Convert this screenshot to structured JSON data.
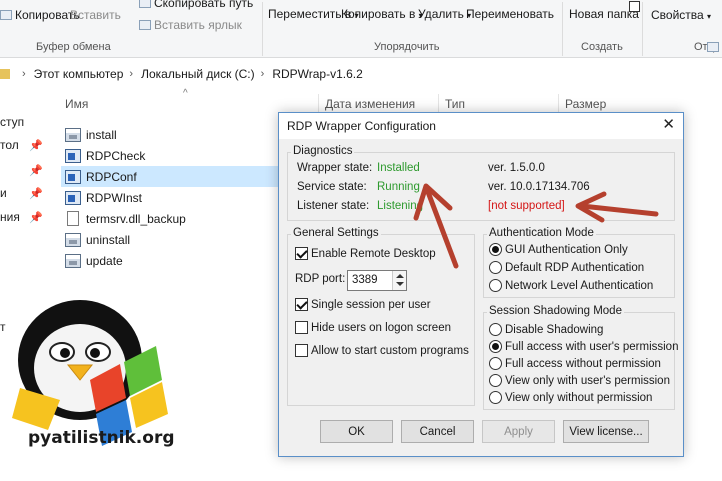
{
  "ribbon": {
    "clipboard": {
      "copy": "Копировать",
      "paste": "Вставить",
      "copy_path": "Скопировать путь",
      "paste_shortcut": "Вставить ярлык",
      "group": "Буфер обмена"
    },
    "organize": {
      "move": "Переместить в",
      "copy_to": "Копировать в",
      "delete": "Удалить",
      "rename": "Переименовать",
      "group": "Упорядочить"
    },
    "create": {
      "new_folder": "Новая папка",
      "group": "Создать"
    },
    "open": {
      "properties": "Свойства",
      "group": "Откр"
    }
  },
  "address": {
    "crumbs": [
      "Этот компьютер",
      "Локальный диск (C:)",
      "RDPWrap-v1.6.2"
    ]
  },
  "columns": [
    "Имя",
    "Дата изменения",
    "Тип",
    "Размер"
  ],
  "nav": [
    "ступ",
    "тол",
    "и",
    "ния",
    "т"
  ],
  "files": [
    {
      "name": "install",
      "icon": "batch-file-icon"
    },
    {
      "name": "RDPCheck",
      "icon": "exe-icon"
    },
    {
      "name": "RDPConf",
      "icon": "exe-icon"
    },
    {
      "name": "RDPWInst",
      "icon": "exe-icon"
    },
    {
      "name": "termsrv.dll_backup",
      "icon": "document-icon"
    },
    {
      "name": "uninstall",
      "icon": "batch-file-icon"
    },
    {
      "name": "update",
      "icon": "batch-file-icon"
    }
  ],
  "dialog": {
    "title": "RDP Wrapper Configuration",
    "diagnostics": {
      "legend": "Diagnostics",
      "wrapper_label": "Wrapper state:",
      "wrapper_value": "Installed",
      "service_label": "Service state:",
      "service_value": "Running",
      "listener_label": "Listener state:",
      "listener_value": "Listening",
      "wrapper_ver": "ver. 1.5.0.0",
      "service_ver": "ver. 10.0.17134.706",
      "listener_support": "[not supported]"
    },
    "general": {
      "legend": "General Settings",
      "enable_rdp": "Enable Remote Desktop",
      "port_label": "RDP port:",
      "port_value": "3389",
      "single_session": "Single session per user",
      "hide_users": "Hide users on logon screen",
      "custom_programs": "Allow to start custom programs"
    },
    "auth": {
      "legend": "Authentication Mode",
      "options": [
        "GUI Authentication Only",
        "Default RDP Authentication",
        "Network Level Authentication"
      ],
      "selected": 0
    },
    "shadow": {
      "legend": "Session Shadowing Mode",
      "options": [
        "Disable Shadowing",
        "Full access with user's permission",
        "Full access without permission",
        "View only with user's permission",
        "View only without permission"
      ],
      "selected": 1
    },
    "buttons": {
      "ok": "OK",
      "cancel": "Cancel",
      "apply": "Apply",
      "license": "View license..."
    }
  },
  "watermark": "pyatilistnik.org",
  "colors": {
    "status_green": "#2e9a2e",
    "status_red": "#d41515",
    "arrow": "#b5402e",
    "selection": "#cce8ff"
  }
}
